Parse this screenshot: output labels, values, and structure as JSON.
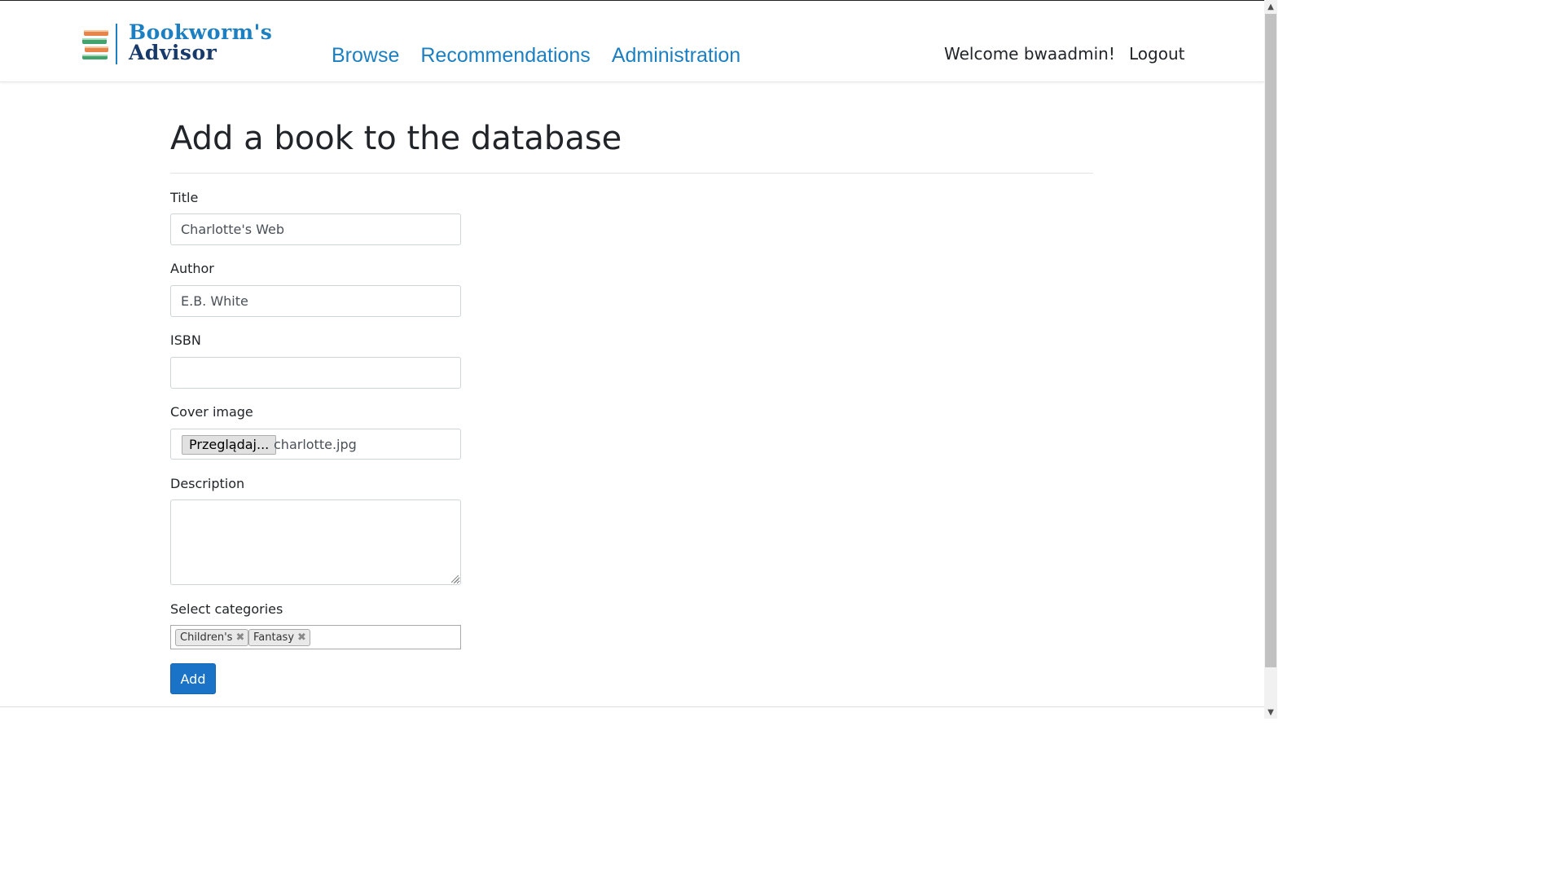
{
  "header": {
    "logo_line1": "Bookworm's",
    "logo_line2": "Advisor",
    "nav": [
      "Browse",
      "Recommendations",
      "Administration"
    ],
    "welcome": "Welcome bwaadmin!",
    "logout": "Logout"
  },
  "main": {
    "title": "Add a book to the database",
    "fields": {
      "title": {
        "label": "Title",
        "value": "Charlotte's Web"
      },
      "author": {
        "label": "Author",
        "value": "E.B. White"
      },
      "isbn": {
        "label": "ISBN",
        "value": ""
      },
      "cover": {
        "label": "Cover image",
        "button": "Przeglądaj...",
        "filename": "charlotte.jpg"
      },
      "description": {
        "label": "Description",
        "value": ""
      },
      "categories": {
        "label": "Select categories",
        "selected": [
          "Children's",
          "Fantasy"
        ],
        "remove_glyph": "✖"
      }
    },
    "submit": "Add"
  },
  "colors": {
    "brand_blue": "#1b7fc1",
    "brand_navy": "#173a6b",
    "button_blue": "#1a73c6"
  },
  "icons": [
    "books-logo-icon",
    "scroll-up-arrow-icon",
    "scroll-down-arrow-icon"
  ]
}
